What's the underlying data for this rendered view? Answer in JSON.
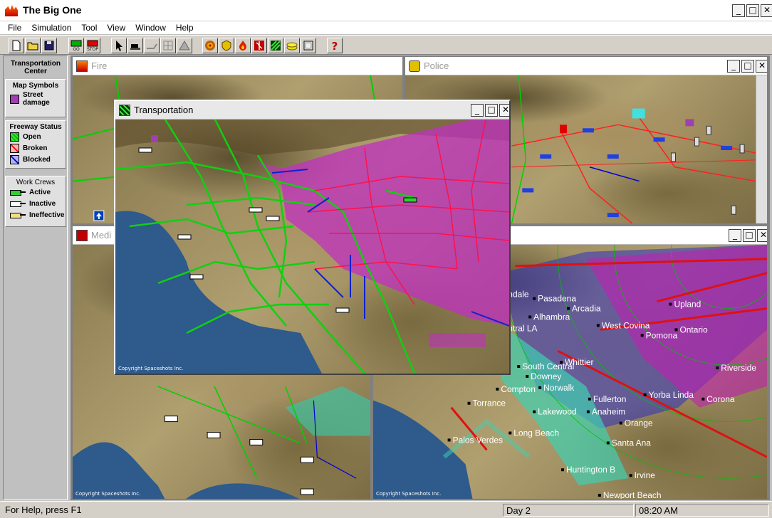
{
  "app": {
    "title": "The Big One"
  },
  "menu": [
    "File",
    "Simulation",
    "Tool",
    "View",
    "Window",
    "Help"
  ],
  "toolbar": {
    "go_label": "GO",
    "stop_label": "STOP",
    "buttons": [
      "new-file-icon",
      "open-folder-icon",
      "save-disk-icon",
      "go-icon",
      "stop-icon",
      "pointer-icon",
      "bulldozer-icon",
      "crane-icon",
      "grid-icon",
      "tent-icon",
      "seismic-icon",
      "police-badge-icon",
      "fire-icon",
      "medical-icon",
      "transportation-icon",
      "utilities-icon",
      "report-icon",
      "help-icon"
    ]
  },
  "legend": {
    "header": "Transportation Center",
    "map_symbols": {
      "title": "Map Symbols",
      "street_damage": "Street damage"
    },
    "freeway_status": {
      "title": "Freeway Status",
      "open": "Open",
      "broken": "Broken",
      "blocked": "Blocked"
    },
    "work_crews": {
      "title": "Work Crews",
      "active": "Active",
      "inactive": "Inactive",
      "ineffective": "Ineffective"
    }
  },
  "windows": {
    "fire": {
      "title": "Fire"
    },
    "police": {
      "title": "Police"
    },
    "medical": {
      "title": "Medi"
    },
    "transportation": {
      "title": "Transportation",
      "copyright": "Copyright Spaceshots Inc."
    },
    "utilities": {
      "copyright": "Copyright Spaceshots Inc."
    },
    "medical_copyright": "Copyright Spaceshots Inc."
  },
  "cities": [
    "Pasadena",
    "Arcadia",
    "Alhambra",
    "ndale",
    "ntral LA",
    "West Covina",
    "Pomona",
    "Upland",
    "Ontario",
    "Whittier",
    "South Central",
    "Downey",
    "Norwalk",
    "Compton",
    "Fullerton",
    "Yorba Linda",
    "Corona",
    "Riverside",
    "Torrance",
    "Lakewood",
    "Anaheim",
    "Orange",
    "Palos Verdes",
    "Long Beach",
    "Santa Ana",
    "Huntington B",
    "Irvine",
    "Newport Beach"
  ],
  "status": {
    "help": "For Help, press F1",
    "day": "Day 2",
    "time": "08:20 AM"
  },
  "colors": {
    "street_damage": "#a040b0",
    "freeway_open": "#00c000",
    "freeway_broken": "#ff0000",
    "freeway_blocked": "#0000c0",
    "water": "#2e5a8c"
  }
}
